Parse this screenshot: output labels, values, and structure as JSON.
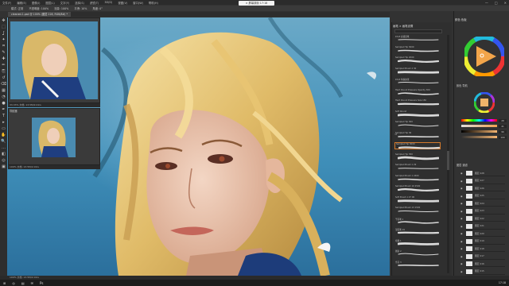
{
  "window": {
    "title": "× 屏幕录制 17:18",
    "controls": [
      "—",
      "□",
      "✕"
    ]
  },
  "menubar": [
    "文件(F)",
    "编辑(E)",
    "图像(I)",
    "图层(L)",
    "文字(Y)",
    "选择(S)",
    "滤镜(T)",
    "3D(D)",
    "视图(V)",
    "窗口(W)",
    "帮助(H)"
  ],
  "options_bar": [
    "模式: 正常",
    "不透明度: 100%",
    "流量: 100%",
    "平滑: 10%",
    "角度: 0°"
  ],
  "document_tab": "cleaned-1.psd @ 100% (图层 228, RGB/8#) *",
  "tools": [
    "move-icon",
    "marquee-icon",
    "lasso-icon",
    "wand-icon",
    "crop-icon",
    "eyedropper-icon",
    "heal-icon",
    "brush-icon",
    "stamp-icon",
    "history-brush-icon",
    "eraser-icon",
    "gradient-icon",
    "blur-icon",
    "dodge-icon",
    "pen-icon",
    "type-icon",
    "path-select-icon",
    "shape-icon",
    "hand-icon",
    "zoom-icon",
    "more-icon",
    "fg-bg-colors-icon",
    "quickmask-icon",
    "screen-mode-icon"
  ],
  "tool_glyphs": [
    "✥",
    "⬚",
    "ʆ",
    "✦",
    "⌗",
    "✎",
    "✚",
    "✏",
    "⎘",
    "↺",
    "⌫",
    "▦",
    "◔",
    "●",
    "✒",
    "T",
    "▸",
    "▭",
    "✋",
    "🔍",
    "…",
    "◧",
    "◎",
    "▣"
  ],
  "navigator": {
    "status": "33.33% 文档: 13.5M/2.01G"
  },
  "preview": {
    "title": "导航器",
    "status": "100% 文档: 13.5M/2.01G"
  },
  "brush_panel": {
    "header": "画笔 × 画笔设置",
    "brushes": [
      {
        "name": "KYLE 超级画笔",
        "size": ""
      },
      {
        "name": "Sampled Tip 3000",
        "size": ""
      },
      {
        "name": "Sampled Tip 2000",
        "size": ""
      },
      {
        "name": "Sampled Brush 2 30",
        "size": ""
      },
      {
        "name": "KYLE 特殊效果",
        "size": ""
      },
      {
        "name": "Hard Round Pressure Opacity 300",
        "size": ""
      },
      {
        "name": "Hard Round Pressure Size 150",
        "size": ""
      },
      {
        "name": "Soft Round",
        "size": ""
      },
      {
        "name": "Sampled Tip 300",
        "size": ""
      },
      {
        "name": "Sampled Tip 36",
        "size": "36"
      },
      {
        "name": "Sampled Tip 3000",
        "size": ""
      },
      {
        "name": "Sampled Tip 350",
        "size": ""
      },
      {
        "name": "Sampled Brush 1 29",
        "size": ""
      },
      {
        "name": "Sampled Brush 1 2400",
        "size": ""
      },
      {
        "name": "Sampled Brush 10 2500",
        "size": ""
      },
      {
        "name": "Soft Brush 1 27 00",
        "size": ""
      },
      {
        "name": "Sampled Brush 13 1500",
        "size": ""
      },
      {
        "name": "干画笔 1",
        "size": ""
      },
      {
        "name": "湿画笔 19",
        "size": ""
      },
      {
        "name": "喷溅 1",
        "size": ""
      },
      {
        "name": "图案 2",
        "size": ""
      },
      {
        "name": "雪花 3",
        "size": ""
      }
    ],
    "selected_index": 10
  },
  "color_panel": {
    "tab": "颜色 色板",
    "tab2": "颜色 导航",
    "sliders": [
      {
        "label": "H",
        "value": "28"
      },
      {
        "label": "S",
        "value": "41"
      },
      {
        "label": "B",
        "value": "96"
      },
      {
        "label": "A",
        "value": "100"
      }
    ]
  },
  "layers_panel": {
    "tab": "图层 通道",
    "layers": [
      "图层 228",
      "图层 227",
      "图层 226",
      "图层 225",
      "图层 224",
      "图层 223",
      "图层 222",
      "图层 221",
      "图层 220",
      "图层 219",
      "图层 218",
      "图层 217",
      "图层 216",
      "图层 215"
    ]
  },
  "status_bar": "100% 文档: 13.5M/2.01G",
  "taskbar": {
    "items": [
      "⊞",
      "◎",
      "▤",
      "✉",
      "Ps"
    ],
    "clock": "17:18"
  },
  "colors": {
    "accent_selection": "#d47a2c",
    "sky_top": "#6ba9c7",
    "sky_bottom": "#2b6f9c",
    "hair": "#e9c779",
    "skin": "#e8c2a8"
  }
}
